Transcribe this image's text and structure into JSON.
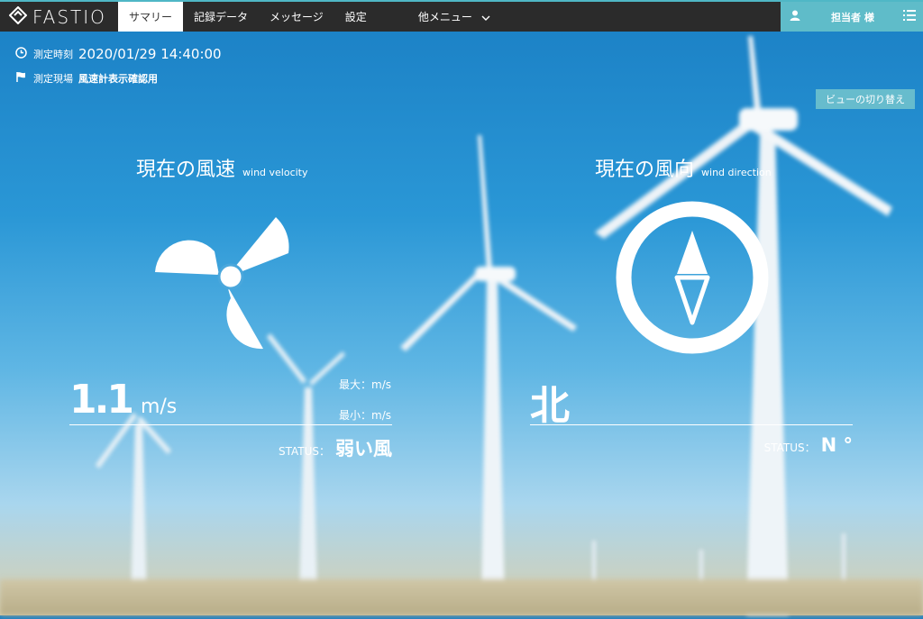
{
  "app": {
    "logo": "FASTIO"
  },
  "nav": {
    "items": [
      {
        "label": "サマリー",
        "active": true
      },
      {
        "label": "記録データ"
      },
      {
        "label": "メッセージ"
      },
      {
        "label": "設定"
      }
    ],
    "more_label": "他メニュー"
  },
  "user": {
    "name": "担当者 様"
  },
  "measurement": {
    "time_label": "測定時刻",
    "time_value": "2020/01/29 14:40:00",
    "site_label": "測定現場",
    "site_value": "風速計表示確認用"
  },
  "view_toggle_label": "ビューの切り替え",
  "wind_speed": {
    "title": "現在の風速",
    "subtitle": "wind velocity",
    "value": "1.1",
    "unit": "m/s",
    "max_label": "最大：m/s",
    "min_label": "最小：m/s",
    "status_label": "STATUS：",
    "status_value": "弱い風"
  },
  "wind_direction": {
    "title": "現在の風向",
    "subtitle": "wind direction",
    "value": "北",
    "status_label": "STATUS：",
    "status_value": "N °"
  },
  "colors": {
    "accent": "#5fbcc9",
    "topbar": "#2b2b2b"
  },
  "icons": [
    "fastio-logo-icon",
    "chevron-down-icon",
    "user-icon",
    "list-menu-icon",
    "clock-icon",
    "flag-icon",
    "fan-icon",
    "compass-icon"
  ]
}
